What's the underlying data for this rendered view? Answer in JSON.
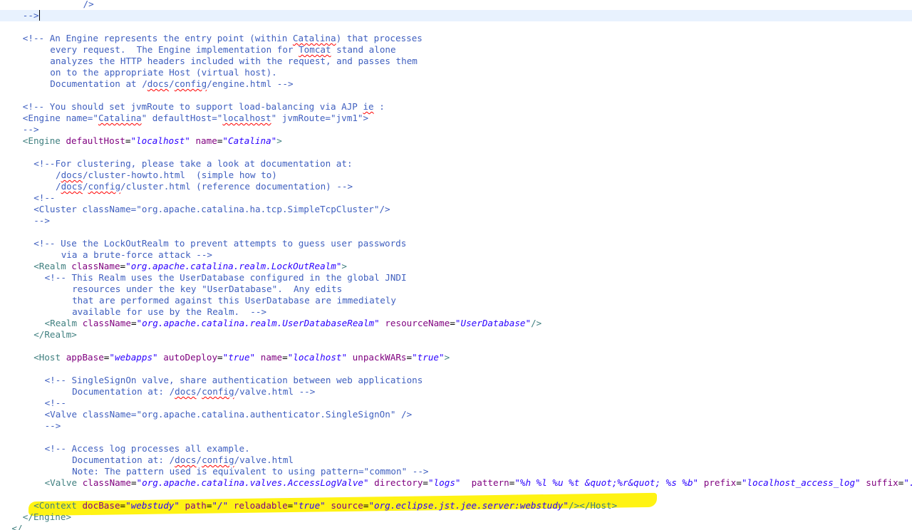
{
  "editor": {
    "colors": {
      "comment": "#3f5fbf",
      "tag": "#3f7f7f",
      "attr_name": "#7f007f",
      "attr_value": "#2a00ff",
      "text": "#000000",
      "current_line": "#e8f2fe",
      "highlight": "#fff200",
      "spell_squiggle": "#ff0000"
    },
    "lines": [
      {
        "indent": 15,
        "tokens": [
          {
            "k": "comment",
            "t": "/>"
          }
        ]
      },
      {
        "indent": 4,
        "current": true,
        "tokens": [
          {
            "k": "comment",
            "t": "-->"
          }
        ]
      },
      {
        "indent": 0,
        "tokens": []
      },
      {
        "indent": 4,
        "tokens": [
          {
            "k": "comment",
            "t": "<!-- An Engine represents the entry point (within "
          },
          {
            "k": "comment",
            "t": "Catalina",
            "sp": true
          },
          {
            "k": "comment",
            "t": ") that processes"
          }
        ]
      },
      {
        "indent": 9,
        "tokens": [
          {
            "k": "comment",
            "t": "every request.  The Engine implementation for "
          },
          {
            "k": "comment",
            "t": "Tomcat",
            "sp": true
          },
          {
            "k": "comment",
            "t": " stand alone"
          }
        ]
      },
      {
        "indent": 9,
        "tokens": [
          {
            "k": "comment",
            "t": "analyzes the HTTP headers included with the request, and passes them"
          }
        ]
      },
      {
        "indent": 9,
        "tokens": [
          {
            "k": "comment",
            "t": "on to the appropriate Host (virtual host)."
          }
        ]
      },
      {
        "indent": 9,
        "tokens": [
          {
            "k": "comment",
            "t": "Documentation at /"
          },
          {
            "k": "comment",
            "t": "docs",
            "sp": true
          },
          {
            "k": "comment",
            "t": "/"
          },
          {
            "k": "comment",
            "t": "config",
            "sp": true
          },
          {
            "k": "comment",
            "t": "/engine.html -->"
          }
        ]
      },
      {
        "indent": 0,
        "tokens": []
      },
      {
        "indent": 4,
        "tokens": [
          {
            "k": "comment",
            "t": "<!-- You should set jvmRoute to support load-balancing via AJP "
          },
          {
            "k": "comment",
            "t": "ie",
            "sp": true
          },
          {
            "k": "comment",
            "t": " :"
          }
        ]
      },
      {
        "indent": 4,
        "tokens": [
          {
            "k": "comment",
            "t": "<Engine name=\""
          },
          {
            "k": "comment",
            "t": "Catalina",
            "sp": true
          },
          {
            "k": "comment",
            "t": "\" defaultHost=\""
          },
          {
            "k": "comment",
            "t": "localhost",
            "sp": true
          },
          {
            "k": "comment",
            "t": "\" jvmRoute=\"jvm1\">"
          }
        ]
      },
      {
        "indent": 4,
        "tokens": [
          {
            "k": "comment",
            "t": "-->"
          }
        ]
      },
      {
        "indent": 4,
        "tokens": [
          {
            "k": "tag",
            "t": "<Engine"
          },
          {
            "k": "text",
            "t": " "
          },
          {
            "k": "attr_name",
            "t": "defaultHost"
          },
          {
            "k": "text",
            "t": "="
          },
          {
            "k": "attr_value",
            "t": "\"localhost\"",
            "i": true
          },
          {
            "k": "text",
            "t": " "
          },
          {
            "k": "attr_name",
            "t": "name"
          },
          {
            "k": "text",
            "t": "="
          },
          {
            "k": "attr_value",
            "t": "\"Catalina\"",
            "i": true
          },
          {
            "k": "tag",
            "t": ">"
          }
        ]
      },
      {
        "indent": 0,
        "tokens": []
      },
      {
        "indent": 6,
        "tokens": [
          {
            "k": "comment",
            "t": "<!--For clustering, please take a look at documentation at:"
          }
        ]
      },
      {
        "indent": 10,
        "tokens": [
          {
            "k": "comment",
            "t": "/"
          },
          {
            "k": "comment",
            "t": "docs",
            "sp": true
          },
          {
            "k": "comment",
            "t": "/cluster-howto.html  (simple how to)"
          }
        ]
      },
      {
        "indent": 10,
        "tokens": [
          {
            "k": "comment",
            "t": "/"
          },
          {
            "k": "comment",
            "t": "docs",
            "sp": true
          },
          {
            "k": "comment",
            "t": "/"
          },
          {
            "k": "comment",
            "t": "config",
            "sp": true
          },
          {
            "k": "comment",
            "t": "/cluster.html (reference documentation) -->"
          }
        ]
      },
      {
        "indent": 6,
        "tokens": [
          {
            "k": "comment",
            "t": "<!--"
          }
        ]
      },
      {
        "indent": 6,
        "tokens": [
          {
            "k": "comment",
            "t": "<Cluster className=\"org.apache.catalina.ha.tcp.SimpleTcpCluster\"/>"
          }
        ]
      },
      {
        "indent": 6,
        "tokens": [
          {
            "k": "comment",
            "t": "-->"
          }
        ]
      },
      {
        "indent": 0,
        "tokens": []
      },
      {
        "indent": 6,
        "tokens": [
          {
            "k": "comment",
            "t": "<!-- Use the LockOutRealm to prevent attempts to guess user passwords"
          }
        ]
      },
      {
        "indent": 11,
        "tokens": [
          {
            "k": "comment",
            "t": "via a brute-force attack -->"
          }
        ]
      },
      {
        "indent": 6,
        "tokens": [
          {
            "k": "tag",
            "t": "<Realm"
          },
          {
            "k": "text",
            "t": " "
          },
          {
            "k": "attr_name",
            "t": "className"
          },
          {
            "k": "text",
            "t": "="
          },
          {
            "k": "attr_value",
            "t": "\"org.apache.catalina.realm.LockOutRealm\"",
            "i": true
          },
          {
            "k": "tag",
            "t": ">"
          }
        ]
      },
      {
        "indent": 8,
        "tokens": [
          {
            "k": "comment",
            "t": "<!-- This Realm uses the UserDatabase configured in the global JNDI"
          }
        ]
      },
      {
        "indent": 13,
        "tokens": [
          {
            "k": "comment",
            "t": "resources under the key \"UserDatabase\".  Any edits"
          }
        ]
      },
      {
        "indent": 13,
        "tokens": [
          {
            "k": "comment",
            "t": "that are performed against this UserDatabase are immediately"
          }
        ]
      },
      {
        "indent": 13,
        "tokens": [
          {
            "k": "comment",
            "t": "available for use by the Realm.  -->"
          }
        ]
      },
      {
        "indent": 8,
        "tokens": [
          {
            "k": "tag",
            "t": "<Realm"
          },
          {
            "k": "text",
            "t": " "
          },
          {
            "k": "attr_name",
            "t": "className"
          },
          {
            "k": "text",
            "t": "="
          },
          {
            "k": "attr_value",
            "t": "\"org.apache.catalina.realm.UserDatabaseRealm\"",
            "i": true
          },
          {
            "k": "text",
            "t": " "
          },
          {
            "k": "attr_name",
            "t": "resourceName"
          },
          {
            "k": "text",
            "t": "="
          },
          {
            "k": "attr_value",
            "t": "\"UserDatabase\"",
            "i": true
          },
          {
            "k": "tag",
            "t": "/>"
          }
        ]
      },
      {
        "indent": 6,
        "tokens": [
          {
            "k": "tag",
            "t": "</Realm>"
          }
        ]
      },
      {
        "indent": 0,
        "tokens": []
      },
      {
        "indent": 6,
        "tokens": [
          {
            "k": "tag",
            "t": "<Host"
          },
          {
            "k": "text",
            "t": " "
          },
          {
            "k": "attr_name",
            "t": "appBase"
          },
          {
            "k": "text",
            "t": "="
          },
          {
            "k": "attr_value",
            "t": "\"webapps\"",
            "i": true
          },
          {
            "k": "text",
            "t": " "
          },
          {
            "k": "attr_name",
            "t": "autoDeploy"
          },
          {
            "k": "text",
            "t": "="
          },
          {
            "k": "attr_value",
            "t": "\"true\"",
            "i": true
          },
          {
            "k": "text",
            "t": " "
          },
          {
            "k": "attr_name",
            "t": "name"
          },
          {
            "k": "text",
            "t": "="
          },
          {
            "k": "attr_value",
            "t": "\"localhost\"",
            "i": true
          },
          {
            "k": "text",
            "t": " "
          },
          {
            "k": "attr_name",
            "t": "unpackWARs"
          },
          {
            "k": "text",
            "t": "="
          },
          {
            "k": "attr_value",
            "t": "\"true\"",
            "i": true
          },
          {
            "k": "tag",
            "t": ">"
          }
        ]
      },
      {
        "indent": 0,
        "tokens": []
      },
      {
        "indent": 8,
        "tokens": [
          {
            "k": "comment",
            "t": "<!-- SingleSignOn valve, share authentication between web applications"
          }
        ]
      },
      {
        "indent": 13,
        "tokens": [
          {
            "k": "comment",
            "t": "Documentation at: /"
          },
          {
            "k": "comment",
            "t": "docs",
            "sp": true
          },
          {
            "k": "comment",
            "t": "/"
          },
          {
            "k": "comment",
            "t": "config",
            "sp": true
          },
          {
            "k": "comment",
            "t": "/valve.html -->"
          }
        ]
      },
      {
        "indent": 8,
        "tokens": [
          {
            "k": "comment",
            "t": "<!--"
          }
        ]
      },
      {
        "indent": 8,
        "tokens": [
          {
            "k": "comment",
            "t": "<Valve className=\"org.apache.catalina.authenticator.SingleSignOn\" />"
          }
        ]
      },
      {
        "indent": 8,
        "tokens": [
          {
            "k": "comment",
            "t": "-->"
          }
        ]
      },
      {
        "indent": 0,
        "tokens": []
      },
      {
        "indent": 8,
        "tokens": [
          {
            "k": "comment",
            "t": "<!-- Access log processes all example."
          }
        ]
      },
      {
        "indent": 13,
        "tokens": [
          {
            "k": "comment",
            "t": "Documentation at: /"
          },
          {
            "k": "comment",
            "t": "docs",
            "sp": true
          },
          {
            "k": "comment",
            "t": "/"
          },
          {
            "k": "comment",
            "t": "config",
            "sp": true
          },
          {
            "k": "comment",
            "t": "/valve.html"
          }
        ]
      },
      {
        "indent": 13,
        "tokens": [
          {
            "k": "comment",
            "t": "Note: The pattern used is equivalent to using pattern=\"common\" -->"
          }
        ]
      },
      {
        "indent": 8,
        "tokens": [
          {
            "k": "tag",
            "t": "<Valve"
          },
          {
            "k": "text",
            "t": " "
          },
          {
            "k": "attr_name",
            "t": "className"
          },
          {
            "k": "text",
            "t": "="
          },
          {
            "k": "attr_value",
            "t": "\"org.apache.catalina.valves.AccessLogValve\"",
            "i": true
          },
          {
            "k": "text",
            "t": " "
          },
          {
            "k": "attr_name",
            "t": "directory"
          },
          {
            "k": "text",
            "t": "="
          },
          {
            "k": "attr_value",
            "t": "\"logs\"",
            "i": true
          },
          {
            "k": "text",
            "t": "  "
          },
          {
            "k": "attr_name",
            "t": "pattern"
          },
          {
            "k": "text",
            "t": "="
          },
          {
            "k": "attr_value",
            "t": "\"%h %l %u %t &quot;%r&quot; %s %b\"",
            "i": true
          },
          {
            "k": "text",
            "t": " "
          },
          {
            "k": "attr_name",
            "t": "prefix"
          },
          {
            "k": "text",
            "t": "="
          },
          {
            "k": "attr_value",
            "t": "\"localhost_access_log\"",
            "i": true
          },
          {
            "k": "text",
            "t": " "
          },
          {
            "k": "attr_name",
            "t": "suffix"
          },
          {
            "k": "text",
            "t": "="
          },
          {
            "k": "attr_value",
            "t": "\".",
            "i": true
          }
        ]
      },
      {
        "indent": 0,
        "tokens": []
      },
      {
        "indent": 6,
        "highlight": true,
        "tokens": [
          {
            "k": "tag",
            "t": "<Context"
          },
          {
            "k": "text",
            "t": " "
          },
          {
            "k": "attr_name",
            "t": "docBase"
          },
          {
            "k": "text",
            "t": "="
          },
          {
            "k": "attr_value",
            "t": "\"webstudy\"",
            "i": true
          },
          {
            "k": "text",
            "t": " "
          },
          {
            "k": "attr_name",
            "t": "path"
          },
          {
            "k": "text",
            "t": "="
          },
          {
            "k": "attr_value",
            "t": "\"/\"",
            "i": true
          },
          {
            "k": "text",
            "t": " "
          },
          {
            "k": "attr_name",
            "t": "reloadable"
          },
          {
            "k": "text",
            "t": "="
          },
          {
            "k": "attr_value",
            "t": "\"true\"",
            "i": true
          },
          {
            "k": "text",
            "t": " "
          },
          {
            "k": "attr_name",
            "t": "source"
          },
          {
            "k": "text",
            "t": "="
          },
          {
            "k": "attr_value",
            "t": "\"org.eclipse.jst.jee.server:webstudy\"",
            "i": true
          },
          {
            "k": "tag",
            "t": "/></Host>"
          }
        ]
      },
      {
        "indent": 4,
        "tokens": [
          {
            "k": "tag",
            "t": "</Engine>"
          }
        ]
      },
      {
        "indent": 2,
        "tokens": [
          {
            "k": "tag",
            "t": "</"
          }
        ]
      }
    ]
  }
}
